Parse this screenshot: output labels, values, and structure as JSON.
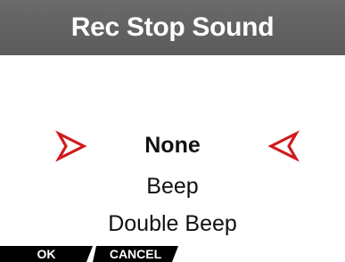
{
  "header": {
    "title": "Rec Stop Sound"
  },
  "options": [
    {
      "label": "None",
      "selected": true
    },
    {
      "label": "Beep",
      "selected": false
    },
    {
      "label": "Double Beep",
      "selected": false
    }
  ],
  "arrows": {
    "icon_left": "arrow-right-outline-icon",
    "icon_right": "arrow-left-outline-icon",
    "color": "#d11a1a"
  },
  "softkeys": {
    "ok_label": "OK",
    "cancel_label": "CANCEL"
  },
  "colors": {
    "header_background": "#626262",
    "header_text": "#ffffff",
    "softkey_background": "#000000",
    "softkey_text": "#ffffff"
  }
}
